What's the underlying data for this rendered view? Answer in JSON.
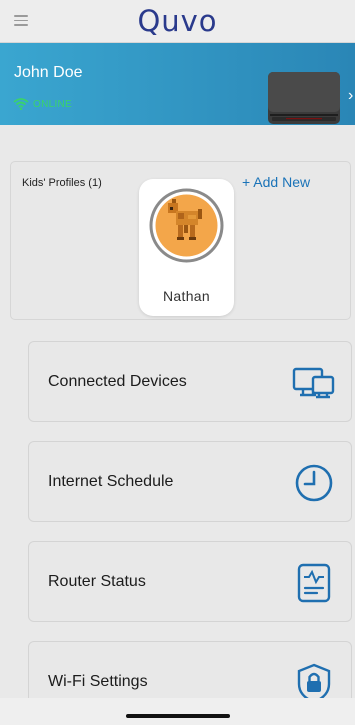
{
  "header": {
    "logo_text": "Quvo"
  },
  "account": {
    "name": "John Doe",
    "status": "ONLINE"
  },
  "kids": {
    "title": "Kids' Profiles (1)",
    "add_new": "+ Add New"
  },
  "profiles": [
    {
      "name": "Nathan"
    }
  ],
  "menu": [
    {
      "label": "Connected Devices",
      "icon": "monitor-icon"
    },
    {
      "label": "Internet Schedule",
      "icon": "clock-icon"
    },
    {
      "label": "Router Status",
      "icon": "status-report-icon"
    },
    {
      "label": "Wi-Fi Settings",
      "icon": "shield-lock-icon"
    }
  ],
  "colors": {
    "accent_blue": "#1a73b8",
    "banner": "#2f93c2",
    "online_green": "#3ad36a",
    "logo": "#2a3a8c"
  }
}
